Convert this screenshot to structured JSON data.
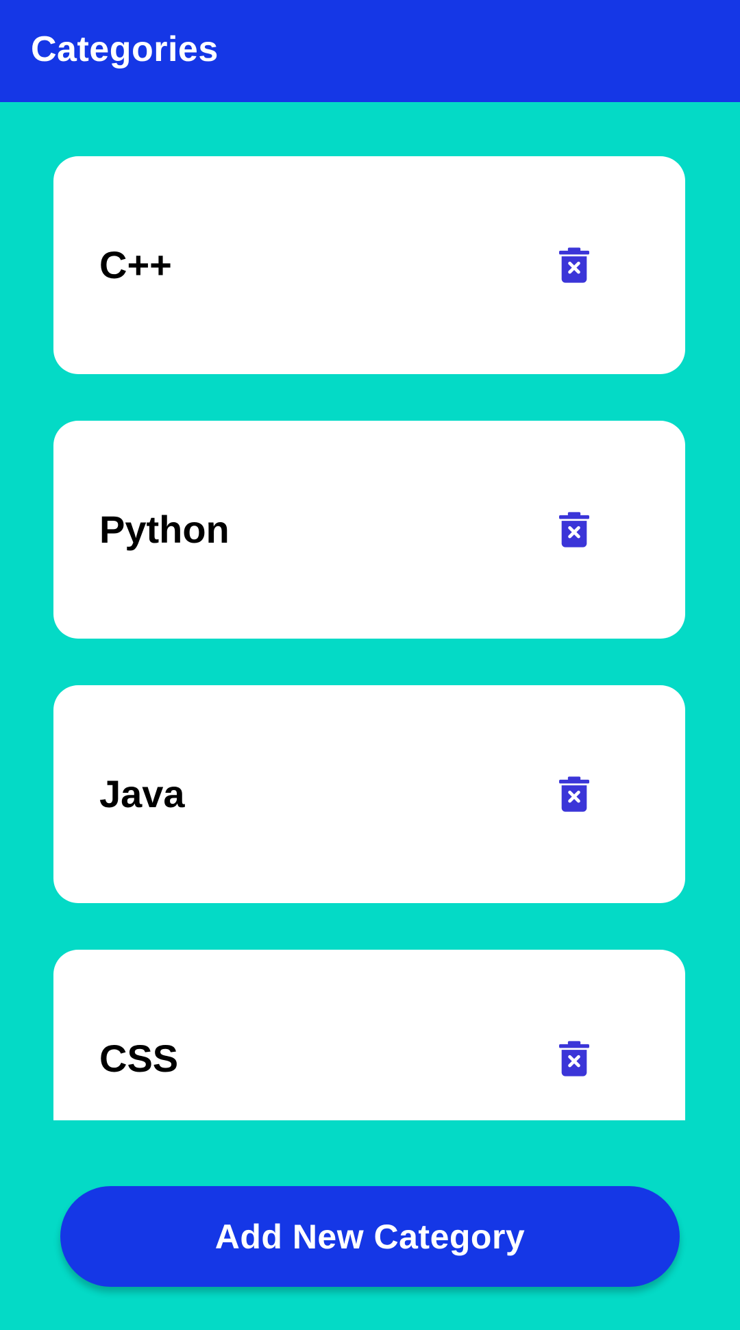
{
  "app_bar": {
    "title": "Categories"
  },
  "colors": {
    "primary": "#1537E6",
    "background": "#04DAC6",
    "card": "#FFFFFF",
    "delete_icon": "#3B35D8",
    "text": "#000000"
  },
  "categories": [
    {
      "name": "C++",
      "action_icon": "delete-forever-icon"
    },
    {
      "name": "Python",
      "action_icon": "delete-forever-icon"
    },
    {
      "name": "Java",
      "action_icon": "delete-forever-icon"
    },
    {
      "name": "CSS",
      "action_icon": "delete-forever-icon"
    }
  ],
  "add_button": {
    "label": "Add New Category"
  }
}
